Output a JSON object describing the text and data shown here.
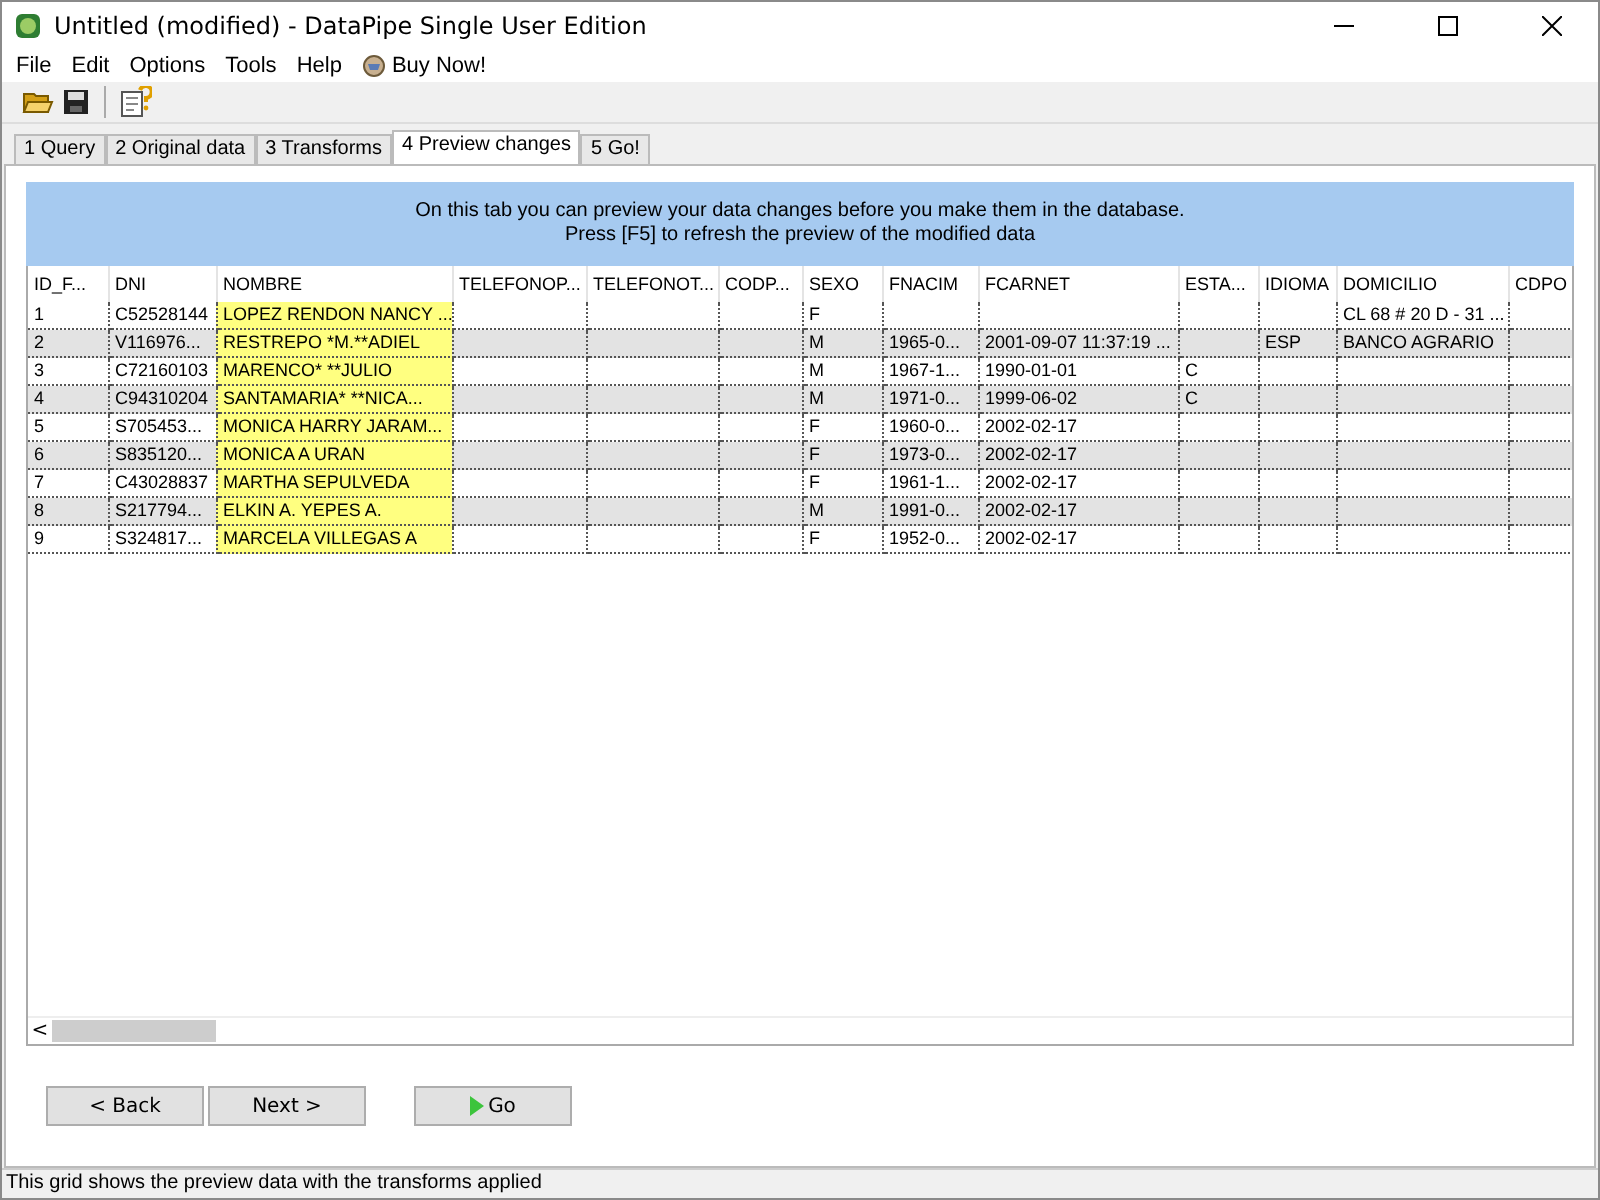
{
  "window": {
    "title": "Untitled (modified) - DataPipe Single User Edition"
  },
  "menu": [
    "File",
    "Edit",
    "Options",
    "Tools",
    "Help",
    "Buy Now!"
  ],
  "tabs": [
    {
      "label": "1 Query",
      "selected": false
    },
    {
      "label": "2 Original data",
      "selected": false
    },
    {
      "label": "3 Transforms",
      "selected": false
    },
    {
      "label": "4 Preview changes",
      "selected": true
    },
    {
      "label": "5 Go!",
      "selected": false
    }
  ],
  "info": [
    "On this tab you can preview your data changes before you make them in the database.",
    "Press [F5] to refresh the preview of the modified data"
  ],
  "table": {
    "columns": [
      {
        "label": "ID_F...",
        "highlighted": false
      },
      {
        "label": "DNI",
        "highlighted": false
      },
      {
        "label": "NOMBRE",
        "highlighted": true
      },
      {
        "label": "TELEFONOP...",
        "highlighted": false
      },
      {
        "label": "TELEFONOT...",
        "highlighted": false
      },
      {
        "label": "CODP...",
        "highlighted": false
      },
      {
        "label": "SEXO",
        "highlighted": false
      },
      {
        "label": "FNACIM",
        "highlighted": false
      },
      {
        "label": "FCARNET",
        "highlighted": false
      },
      {
        "label": "ESTA...",
        "highlighted": false
      },
      {
        "label": "IDIOMA",
        "highlighted": false
      },
      {
        "label": "DOMICILIO",
        "highlighted": false
      },
      {
        "label": "CDPO",
        "highlighted": false
      }
    ],
    "rows": [
      [
        "1",
        "C52528144",
        "LOPEZ RENDON NANCY ...",
        "",
        "",
        "",
        "F",
        "",
        "",
        "",
        "",
        "CL 68 # 20 D - 31 ...",
        ""
      ],
      [
        "2",
        "V116976...",
        "RESTREPO *M.**ADIEL",
        "",
        "",
        "",
        "M",
        "1965-0...",
        "2001-09-07 11:37:19 ...",
        "",
        "ESP",
        "BANCO AGRARIO",
        ""
      ],
      [
        "3",
        "C72160103",
        "MARENCO* **JULIO",
        "",
        "",
        "",
        "M",
        "1967-1...",
        "1990-01-01",
        "C",
        "",
        "",
        ""
      ],
      [
        "4",
        "C94310204",
        "SANTAMARIA* **NICA...",
        "",
        "",
        "",
        "M",
        "1971-0...",
        "1999-06-02",
        "C",
        "",
        "",
        ""
      ],
      [
        "5",
        "S705453...",
        "MONICA HARRY JARAM...",
        "",
        "",
        "",
        "F",
        "1960-0...",
        "2002-02-17",
        "",
        "",
        "",
        ""
      ],
      [
        "6",
        "S835120...",
        "MONICA A URAN",
        "",
        "",
        "",
        "F",
        "1973-0...",
        "2002-02-17",
        "",
        "",
        "",
        ""
      ],
      [
        "7",
        "C43028837",
        "MARTHA SEPULVEDA",
        "",
        "",
        "",
        "F",
        "1961-1...",
        "2002-02-17",
        "",
        "",
        "",
        ""
      ],
      [
        "8",
        "S217794...",
        "ELKIN A. YEPES A.",
        "",
        "",
        "",
        "M",
        "1991-0...",
        "2002-02-17",
        "",
        "",
        "",
        ""
      ],
      [
        "9",
        "S324817...",
        "MARCELA VILLEGAS A",
        "",
        "",
        "",
        "F",
        "1952-0...",
        "2002-02-17",
        "",
        "",
        "",
        ""
      ]
    ]
  },
  "scrollbar_arrow": "<",
  "buttons": [
    "< Back",
    "Next >",
    "Go"
  ],
  "status_bar": "This grid shows the preview data with the transforms applied"
}
